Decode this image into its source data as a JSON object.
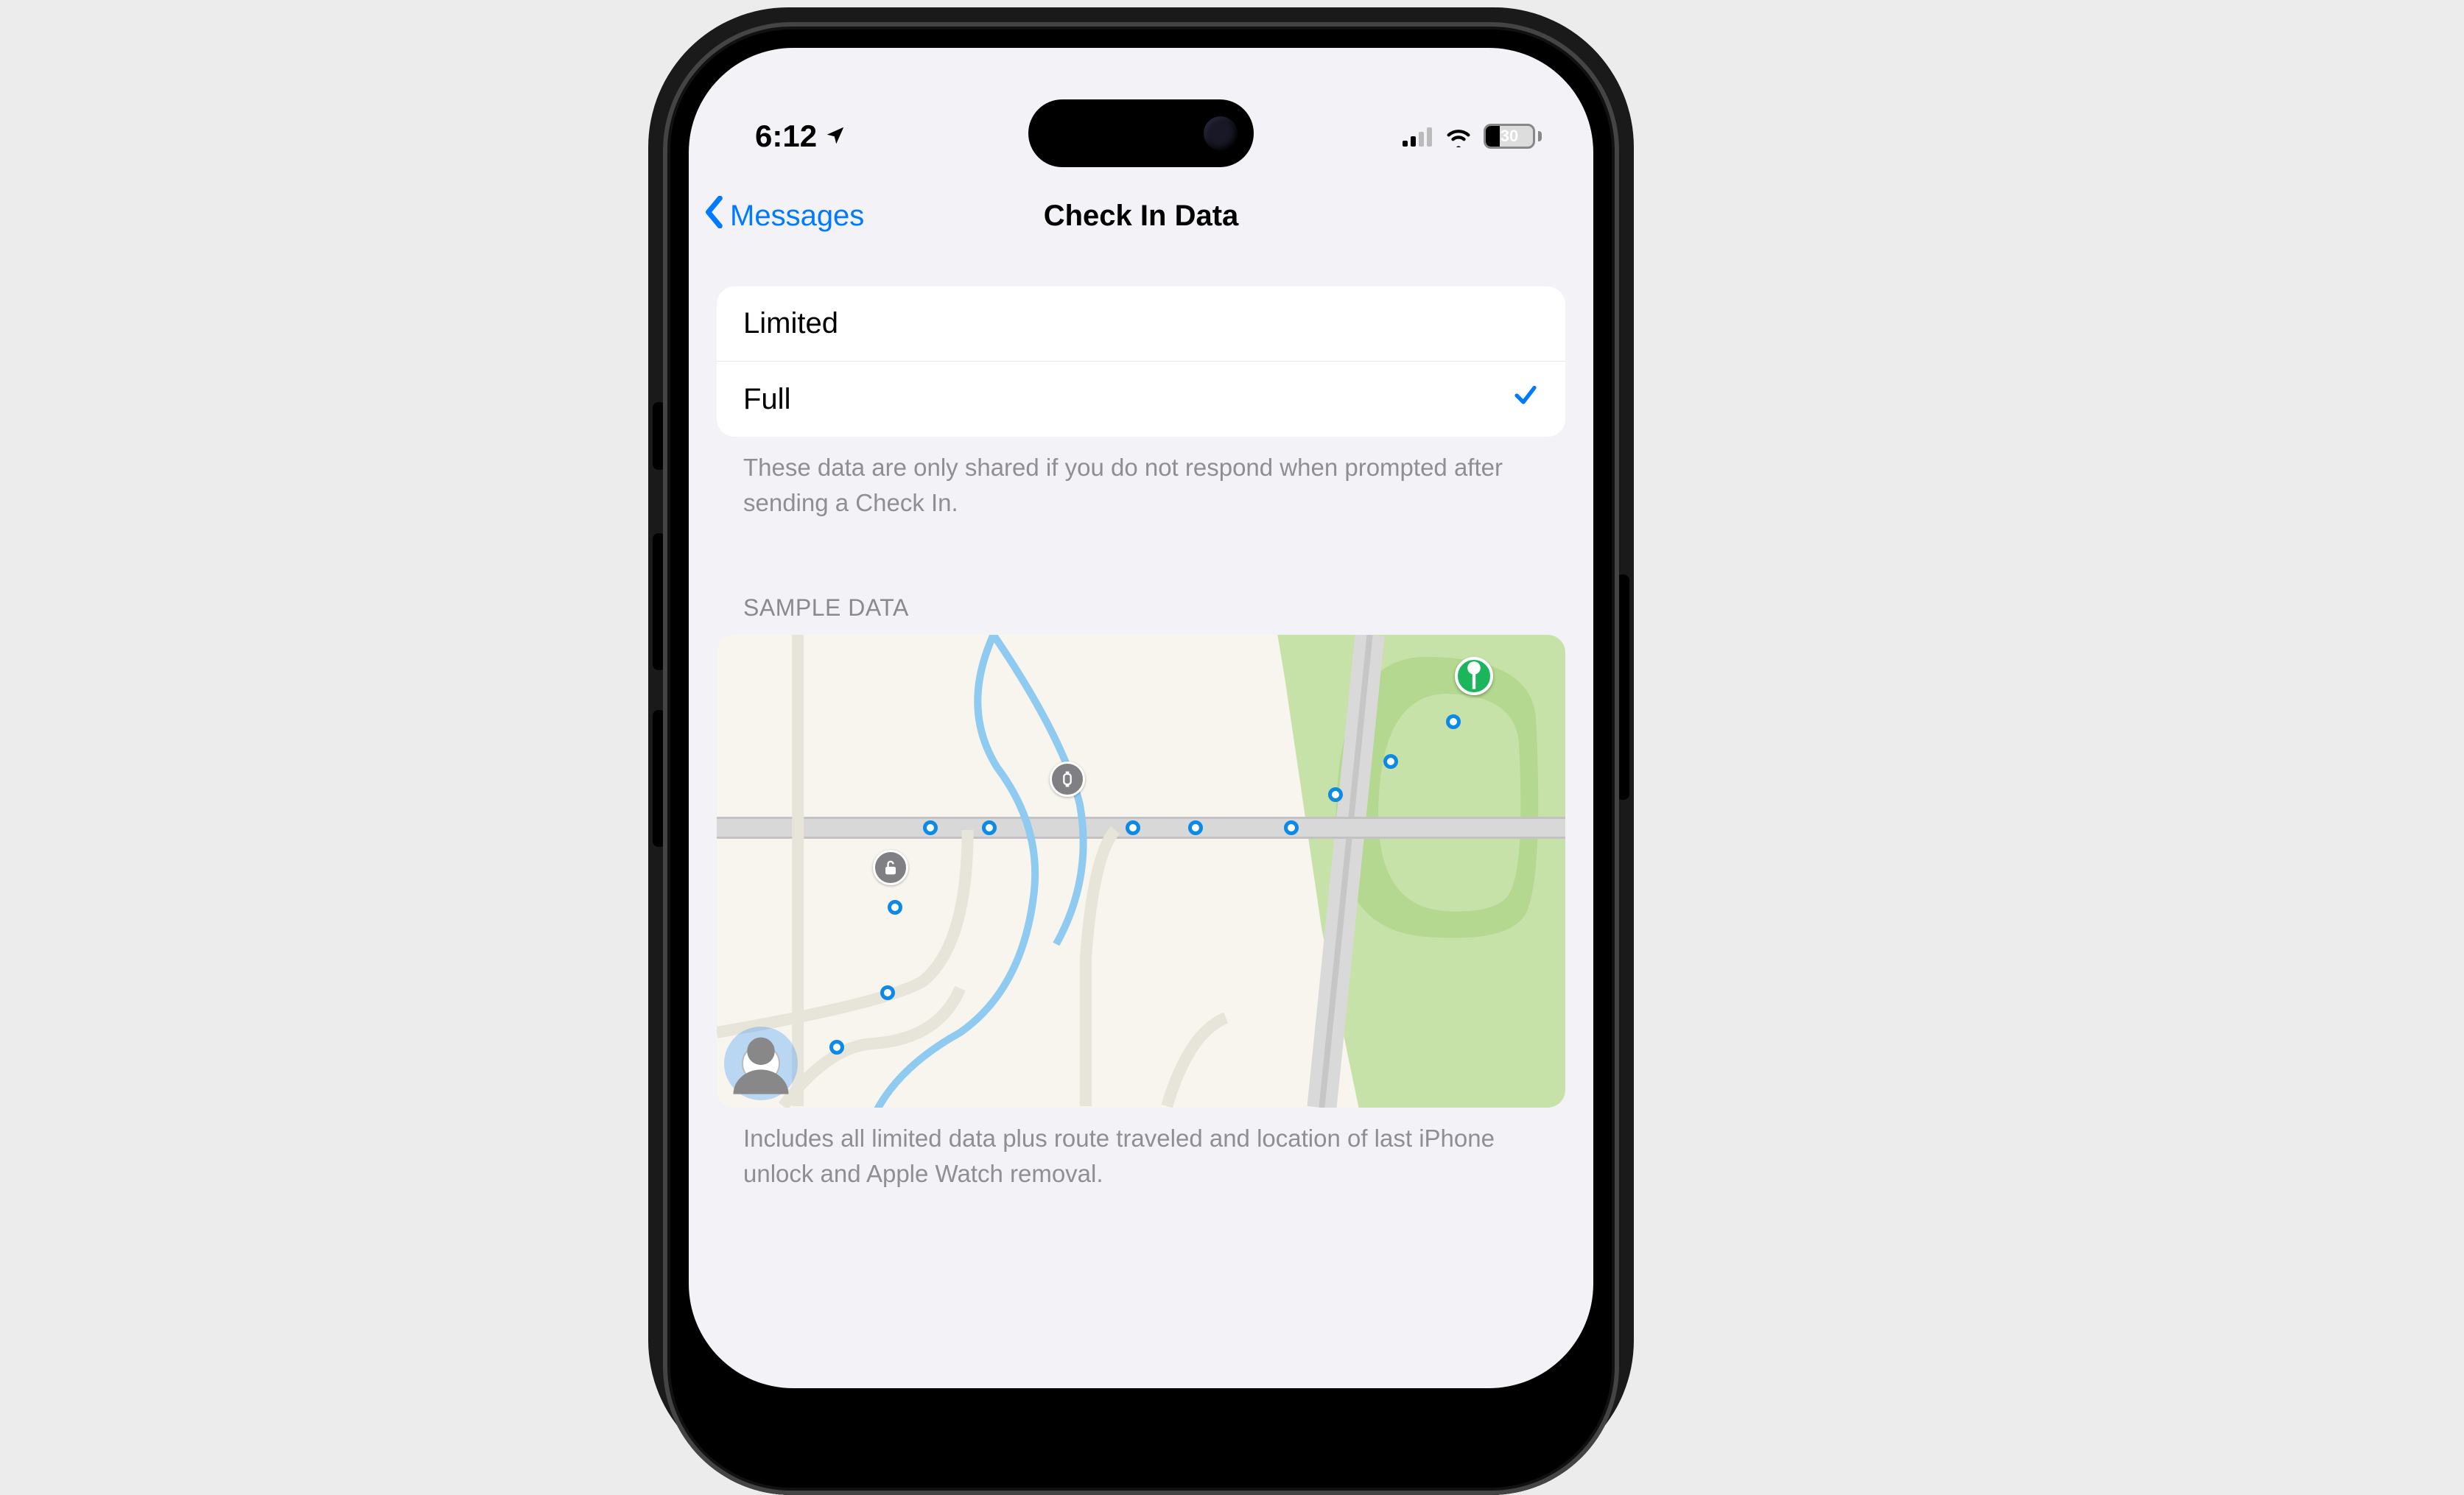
{
  "statusbar": {
    "time": "6:12",
    "battery_percent": "30"
  },
  "nav": {
    "back_label": "Messages",
    "title": "Check In Data"
  },
  "options": {
    "limited_label": "Limited",
    "full_label": "Full",
    "selected": "full",
    "footer": "These data are only shared if you do not respond when prompted after sending a Check In."
  },
  "sample": {
    "header": "SAMPLE DATA",
    "footer": "Includes all limited data plus route traveled and location of last iPhone unlock and Apple Watch removal."
  },
  "colors": {
    "ios_blue": "#007aff",
    "gray_text": "#8e8e93",
    "green_pin": "#1bb55c"
  }
}
